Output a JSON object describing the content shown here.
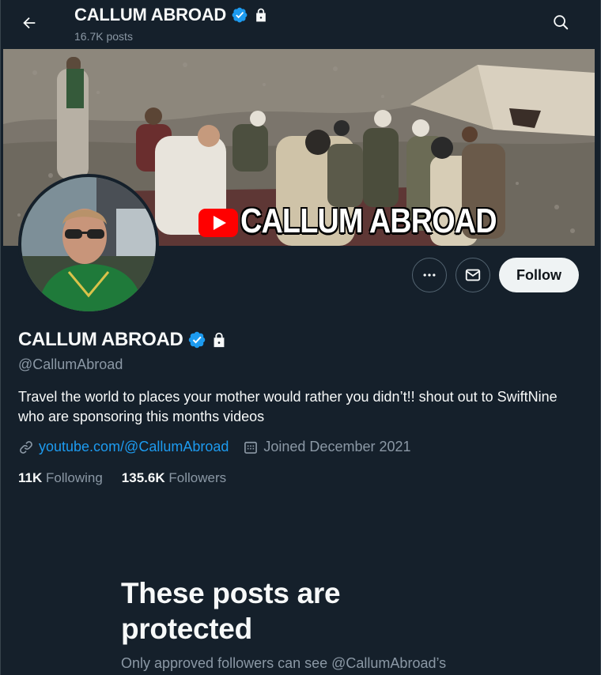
{
  "header": {
    "name": "CALLUM ABROAD",
    "post_count": "16.7K posts"
  },
  "banner": {
    "overlay_text": "CALLUM ABROAD"
  },
  "profile": {
    "display_name": "CALLUM ABROAD",
    "handle": "@CallumAbroad",
    "bio": "Travel the world to places your mother would rather you didn’t!! shout out to SwiftNine who are sponsoring this months videos",
    "link": "youtube.com/@CallumAbroad",
    "joined": "Joined December 2021",
    "following_count": "11K",
    "following_label": "Following",
    "followers_count": "135.6K",
    "followers_label": "Followers"
  },
  "actions": {
    "follow_label": "Follow"
  },
  "protected": {
    "title": "These posts are protected",
    "subtitle": "Only approved followers can see @CallumAbroad’s"
  },
  "colors": {
    "background": "#15202b",
    "accent": "#1d9bf0",
    "secondary_text": "#8b98a5",
    "verified": "#1d9bf0",
    "follow_button": "#eff3f4"
  }
}
